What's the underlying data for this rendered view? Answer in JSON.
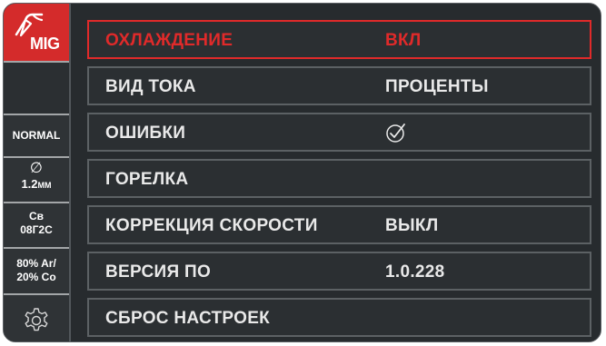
{
  "sidebar": {
    "mode": "MIG",
    "profile": "NORMAL",
    "diameter_symbol": "∅",
    "diameter_value": "1.2",
    "diameter_unit": "ММ",
    "wire_line1": "Св",
    "wire_line2": "08Г2С",
    "gas_line1": "80% Ar/",
    "gas_line2": "20% Co",
    "settings_icon": "gear-icon"
  },
  "menu": {
    "items": [
      {
        "label": "ОХЛАЖДЕНИЕ",
        "value": "ВКЛ"
      },
      {
        "label": "ВИД ТОКА",
        "value": "ПРОЦЕНТЫ"
      },
      {
        "label": "ОШИБКИ",
        "value_icon": "check-circle-icon"
      },
      {
        "label": "ГОРЕЛКА",
        "value": ""
      },
      {
        "label": "КОРРЕКЦИЯ СКОРОСТИ",
        "value": "ВЫКЛ"
      },
      {
        "label": "ВЕРСИЯ ПО",
        "value": "1.0.228"
      },
      {
        "label": "СБРОС НАСТРОЕК",
        "value": ""
      }
    ],
    "selected_index": 0
  },
  "colors": {
    "accent": "#d42b2b",
    "background": "#272b2e",
    "text": "#e9e9e9"
  }
}
